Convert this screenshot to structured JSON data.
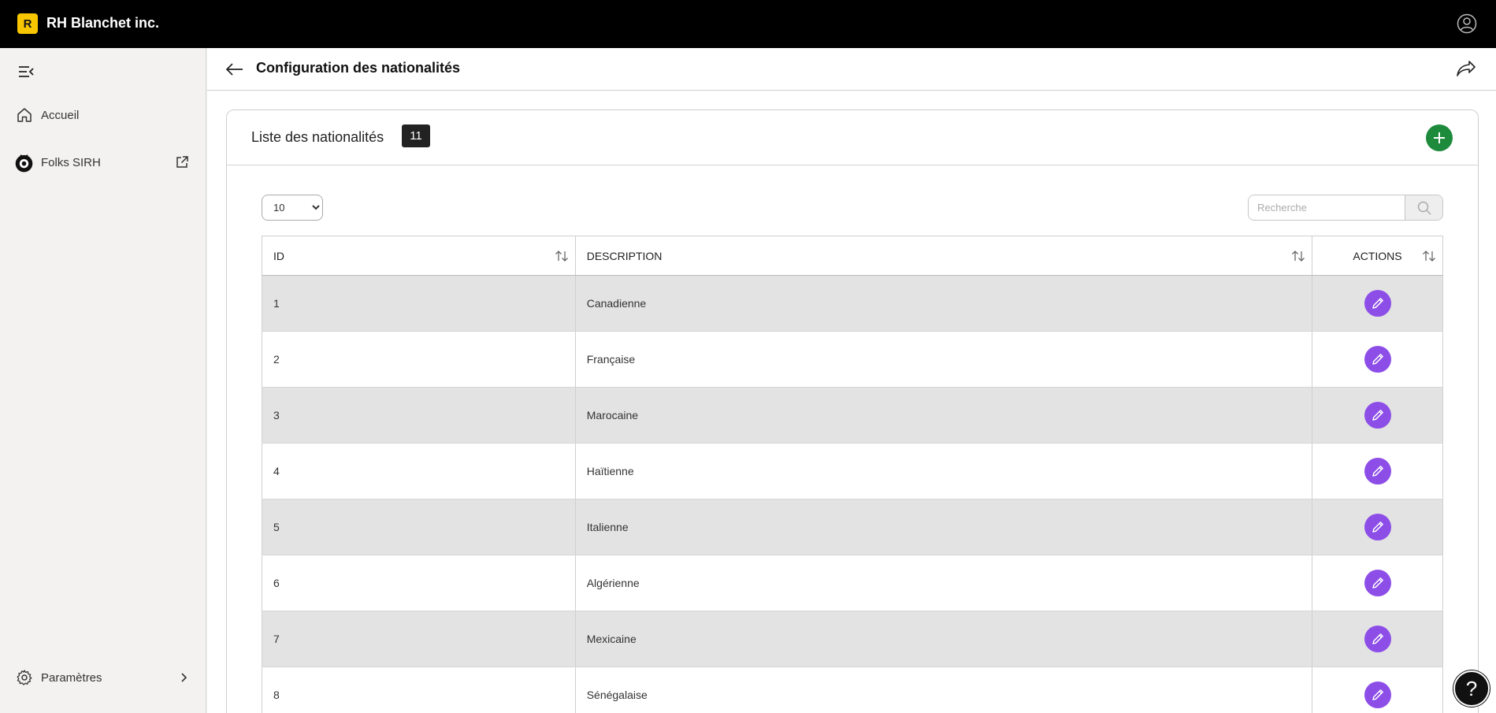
{
  "app": {
    "logo_letter": "R",
    "brand": "RH Blanchet inc."
  },
  "sidebar": {
    "items": [
      {
        "label": "Accueil",
        "icon": "home-icon"
      },
      {
        "label": "Folks SIRH",
        "icon": "folks-logo-icon"
      }
    ],
    "settings_label": "Paramètres"
  },
  "header": {
    "title": "Configuration des nationalités"
  },
  "card": {
    "title": "Liste des nationalités",
    "count": "11"
  },
  "controls": {
    "page_size": "10",
    "page_size_options": [
      "10"
    ],
    "search_placeholder": "Recherche"
  },
  "table": {
    "columns": [
      "ID",
      "DESCRIPTION",
      "ACTIONS"
    ],
    "rows": [
      {
        "id": "1",
        "description": "Canadienne"
      },
      {
        "id": "2",
        "description": "Française"
      },
      {
        "id": "3",
        "description": "Marocaine"
      },
      {
        "id": "4",
        "description": "Haïtienne"
      },
      {
        "id": "5",
        "description": "Italienne"
      },
      {
        "id": "6",
        "description": "Algérienne"
      },
      {
        "id": "7",
        "description": "Mexicaine"
      },
      {
        "id": "8",
        "description": "Sénégalaise"
      }
    ]
  },
  "help": {
    "label": "?"
  },
  "colors": {
    "accent_green": "#1e8a3c",
    "edit_purple": "#8d4ee8",
    "logo_yellow": "#f7c600"
  }
}
